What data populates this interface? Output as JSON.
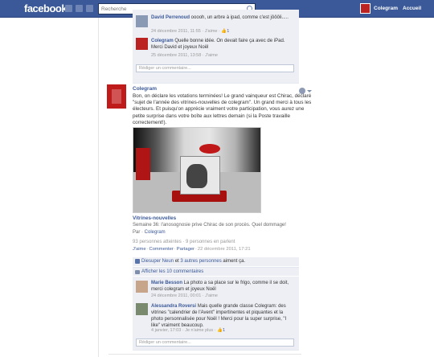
{
  "topbar": {
    "logo": "facebook",
    "search_placeholder": "Recherche",
    "user_name": "Colegram",
    "home_label": "Accueil"
  },
  "prev_comments": [
    {
      "author": "David Perrenoud",
      "text": " ooooh, un arbre à ipad, comme c'est jôôôli.....",
      "meta": "24 décembre 2011, 11:55 · J'aime · ",
      "likes": "1"
    },
    {
      "author": "Colegram",
      "text": " Quelle bonne idée. On devait faire ça avec de iPad. Merci David et joyeux Noël",
      "meta": "25 décembre 2011, 13:58 · J'aime"
    }
  ],
  "write_comment_placeholder": "Rédiger un commentaire...",
  "post": {
    "author": "Colegram",
    "body": "Bon, on déclare les votations terminées! Le grand vainqueur est Chirac, déclaré \"sujet de l'année des vitrines-nouvelles de colegram\". Un grand merci à tous les électeurs. Et puisqu'on apprécie vraiment votre participation, vous aurez une petite surprise dans votre boîte aux lettres demain (si la Poste travaille correctement!).",
    "album_title": "Vitrines-nouvelles",
    "album_subtitle": "Semaine 36: l'anosognosie prive Chirac de son procès. Quel dommage!",
    "album_by_prefix": "Par · ",
    "album_by_name": "Colegram",
    "stats": "93 personnes atteintes · 9 personnes en parlent",
    "action_like": "J'aime",
    "action_comment": "Commenter",
    "action_share": "Partager",
    "action_date": "22 décembre 2011, 17:21",
    "likes_line_name": "Diesuper Neun",
    "likes_line_mid": " et ",
    "likes_line_others": "3 autres personnes",
    "likes_line_suffix": " aiment ça.",
    "show_more": "Afficher les 10 commentaires"
  },
  "post_comments": [
    {
      "author": "Marie Besson",
      "text": " La photo a sa place sur le frigo, comme il se doit, merci colegram et joyeux Noël",
      "meta": "24 décembre 2011, 00:01 · J'aime"
    },
    {
      "author": "Alessandra Roversi",
      "text": " Mais quelle grande classe Colegram: des vitrines \"calendrier de l'Avent\" impertinentes et piquantes et la photo personnalisée pour Noël ! Merci pour la super surprise, \"I like\" vraiment beaucoup.",
      "meta": "4 janvier, 17:03 · Je n'aime plus · ",
      "likes": "1"
    }
  ]
}
